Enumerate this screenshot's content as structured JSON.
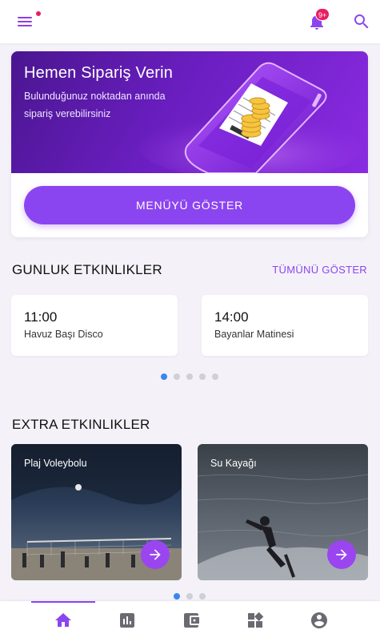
{
  "header": {
    "notification_badge": "9+",
    "accent_color": "#8b45f0",
    "badge_color": "#e91e63",
    "icons": [
      "menu-icon",
      "bell-icon",
      "search-icon"
    ]
  },
  "hero": {
    "title": "Hemen Sipariş Verin",
    "subtitle": "Bulunduğunuz noktadan anında sipariş verebilirsiniz",
    "button_label": "MENÜYÜ GÖSTER"
  },
  "daily": {
    "title": "GUNLUK ETKINLIKLER",
    "see_all": "TÜMÜNÜ GÖSTER",
    "events": [
      {
        "time": "11:00",
        "name": "Havuz Başı Disco"
      },
      {
        "time": "14:00",
        "name": "Bayanlar Matinesi"
      }
    ],
    "page_count": 5,
    "active_page": 1
  },
  "extra": {
    "title": "EXTRA ETKINLIKLER",
    "items": [
      {
        "label": "Plaj Voleybolu",
        "icon": "arrow-right-icon"
      },
      {
        "label": "Su Kayağı",
        "icon": "arrow-right-icon"
      }
    ],
    "page_count": 3,
    "active_page": 1
  },
  "bottom_nav": {
    "items": [
      "home-icon",
      "stats-icon",
      "wallet-icon",
      "widgets-icon",
      "account-icon"
    ],
    "active": "home-icon"
  }
}
